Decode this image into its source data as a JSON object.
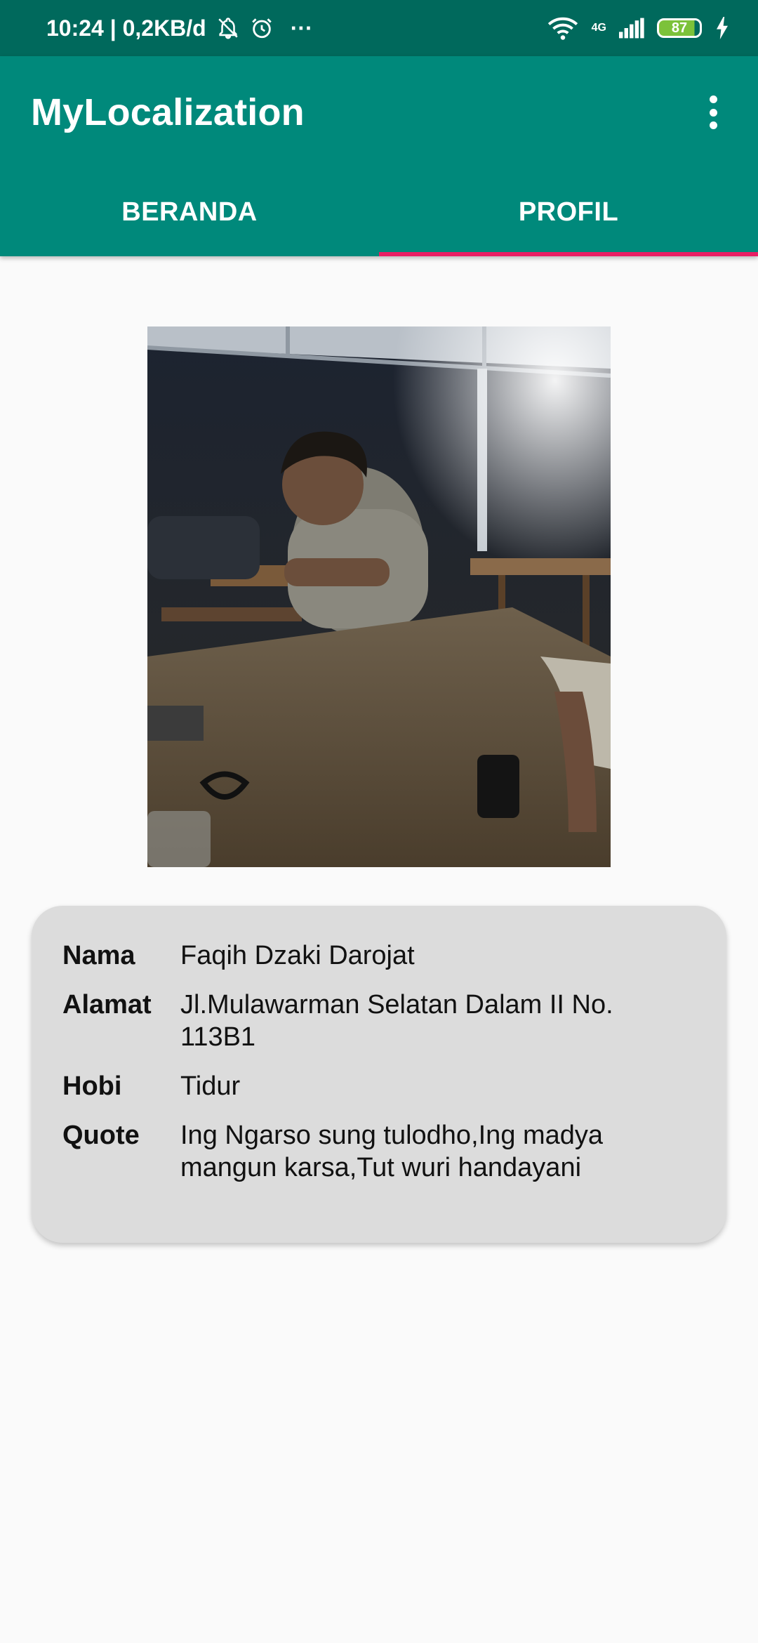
{
  "status_bar": {
    "time_and_speed": "10:24 | 0,2KB/d",
    "more": "···",
    "network_type": "4G",
    "battery": "87"
  },
  "app_bar": {
    "title": "MyLocalization"
  },
  "tabs": [
    {
      "label": "BERANDA",
      "active": false
    },
    {
      "label": "PROFIL",
      "active": true
    }
  ],
  "colors": {
    "status_bar": "#00695c",
    "app_bar": "#00897b",
    "tab_indicator": "#e91e63",
    "card": "#dcdcdc"
  },
  "profile": {
    "rows": [
      {
        "label": "Nama",
        "value": "Faqih Dzaki Darojat"
      },
      {
        "label": "Alamat",
        "value": "Jl.Mulawarman Selatan Dalam II No. 113B1"
      },
      {
        "label": "Hobi",
        "value": "Tidur"
      },
      {
        "label": "Quote",
        "value": "Ing Ngarso sung tulodho,Ing madya mangun karsa,Tut wuri handayani"
      }
    ]
  }
}
